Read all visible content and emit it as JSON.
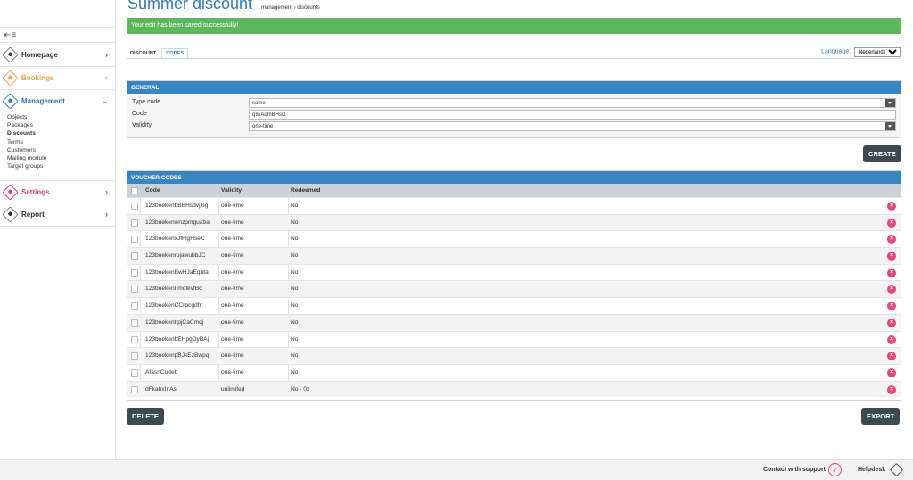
{
  "page": {
    "title": "Summer discount",
    "breadcrumb": "management › discounts",
    "alert": "Your edit has been saved successfully!"
  },
  "sidebar": {
    "collapse_icon": "menu-collapse-icon",
    "items": [
      {
        "label": "Homepage",
        "icon": "home-icon"
      },
      {
        "label": "Bookings",
        "icon": "bookings-icon"
      },
      {
        "label": "Management",
        "icon": "management-icon"
      },
      {
        "label": "Settings",
        "icon": "settings-icon"
      },
      {
        "label": "Report",
        "icon": "report-icon"
      }
    ],
    "submenu": [
      "Objects",
      "Packages",
      "Discounts",
      "Terms",
      "Customers",
      "Mailing module",
      "Target groups"
    ]
  },
  "tabs": [
    "DISCOUNT",
    "CODES"
  ],
  "language": {
    "label": "Language:",
    "value": "Nederlands"
  },
  "general": {
    "title": "GENERAL",
    "fields": [
      {
        "label": "Type code",
        "value": "some"
      },
      {
        "label": "Code",
        "value": "qIwAqmBHsG"
      },
      {
        "label": "Validity",
        "value": "one-time"
      }
    ],
    "create_label": "CREATE"
  },
  "vouchers": {
    "title": "VOUCHER CODES",
    "columns": [
      "Code",
      "Validity",
      "Redeemed"
    ],
    "rows": [
      {
        "code": "123boekenbBBHsdvjGg",
        "validity": "one-time",
        "redeemed": "No"
      },
      {
        "code": "123boekenwnzpmguaba",
        "validity": "one-time",
        "redeemed": "No"
      },
      {
        "code": "123boekenxJfFlgHseC",
        "validity": "one-time",
        "redeemed": "No"
      },
      {
        "code": "123boekenrujawubbJC",
        "validity": "one-time",
        "redeemed": "No"
      },
      {
        "code": "123boekenBwHJaEquta",
        "validity": "one-time",
        "redeemed": "No"
      },
      {
        "code": "123boekenIImdtkvfBc",
        "validity": "one-time",
        "redeemed": "No"
      },
      {
        "code": "123boekenCCrpcgdfrt",
        "validity": "one-time",
        "redeemed": "No"
      },
      {
        "code": "123boekenttpjCaCmqj",
        "validity": "one-time",
        "redeemed": "No"
      },
      {
        "code": "123boekenbEHpgDyBAj",
        "validity": "one-time",
        "redeemed": "No"
      },
      {
        "code": "123boekenpBJkEzBwpq",
        "validity": "one-time",
        "redeemed": "No"
      },
      {
        "code": "AfasnCudeb",
        "validity": "one-time",
        "redeemed": "No"
      },
      {
        "code": "dFkahxInAs",
        "validity": "unlimited",
        "redeemed": "No - 0x"
      }
    ],
    "delete_label": "DELETE",
    "export_label": "EXPORT"
  },
  "footer": {
    "support": "Contact with support",
    "helpdesk": "Helpdesk"
  },
  "colors": {
    "primary": "#3785c3",
    "success": "#5cb85c",
    "bookings": "#f2a33a",
    "settings": "#e03c6b",
    "button": "#3d4a52"
  }
}
